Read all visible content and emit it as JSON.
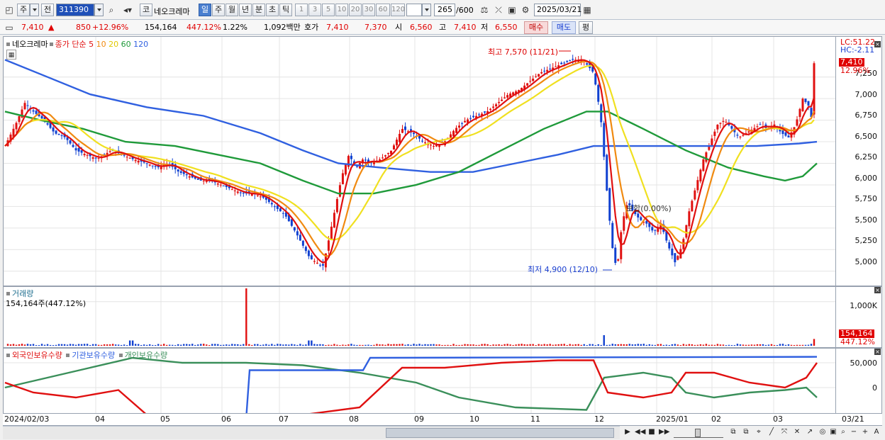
{
  "toolbar": {
    "period_jo": "주",
    "jeon": "전",
    "code": "311390",
    "ko": "코",
    "stock_name": "네오크레마",
    "periods": [
      "일",
      "주",
      "월",
      "년",
      "분",
      "초",
      "틱"
    ],
    "period_selected": "일",
    "numbers": [
      "1",
      "3",
      "5",
      "10",
      "20",
      "30",
      "60",
      "120"
    ],
    "count": "265",
    "count_total": "/600",
    "date": "2025/03/21"
  },
  "quote": {
    "price": "7,410",
    "arrow": "▲",
    "change": "850",
    "change_pct": "+12.96%",
    "volume": "154,164",
    "vol_ratio": "447.12%",
    "turnover": "1.22%",
    "amount": "1,092백만",
    "hoga_label": "호가",
    "ask": "7,410",
    "bid": "7,370",
    "open_label": "시",
    "open": "6,560",
    "high_label": "고",
    "high": "7,410",
    "low_label": "저",
    "low": "6,550",
    "buy": "매수",
    "sell": "매도",
    "eval": "평"
  },
  "price_panel": {
    "stock_name": "네오크레마",
    "ma_label": "종가 단순",
    "ma_periods": [
      "5",
      "10",
      "20",
      "60",
      "120"
    ],
    "ma_colors": [
      "#e01010",
      "#f08a10",
      "#f0e020",
      "#1f9a3a",
      "#3060e0"
    ],
    "y_ticks": [
      "7,250",
      "7,000",
      "6,750",
      "6,500",
      "6,250",
      "6,000",
      "5,750",
      "5,500",
      "5,250",
      "5,000"
    ],
    "lc": "LC:51.22",
    "hc": "HC:-2.11",
    "last_price": "7,410",
    "last_pct": "12.96%",
    "high_annot": "최고 7,570 (11/21)",
    "low_annot": "최저 4,900 (12/10)",
    "mid_annot": "보합(0.00%)"
  },
  "volume_panel": {
    "title": "거래량",
    "value": "154,164주(447.12%)",
    "y_tick": "1,000K",
    "last": "154,164",
    "last_pct": "447.12%"
  },
  "holding_panel": {
    "series": [
      "외국인보유수량",
      "기관보유수량",
      "개인보유수량"
    ],
    "colors": [
      "#e01010",
      "#3060e0",
      "#3a8f5a"
    ],
    "y_ticks": [
      "50,000",
      "0"
    ]
  },
  "x_axis": {
    "labels": [
      "2024/02/03",
      "04",
      "05",
      "06",
      "07",
      "08",
      "09",
      "10",
      "11",
      "12",
      "2025/01",
      "02",
      "03",
      "03/21"
    ]
  },
  "chart_data": [
    {
      "type": "candlestick",
      "title": "네오크레마 종가 단순 5 10 20 60 120",
      "ylim": [
        4850,
        7650
      ],
      "y_ticks": [
        5000,
        5250,
        5500,
        5750,
        6000,
        6250,
        6500,
        6750,
        7000,
        7250
      ],
      "close_path": [
        [
          0,
          6450
        ],
        [
          15,
          6700
        ],
        [
          28,
          6950
        ],
        [
          40,
          6850
        ],
        [
          55,
          6750
        ],
        [
          70,
          6600
        ],
        [
          85,
          6550
        ],
        [
          100,
          6400
        ],
        [
          115,
          6350
        ],
        [
          130,
          6300
        ],
        [
          150,
          6400
        ],
        [
          165,
          6350
        ],
        [
          180,
          6300
        ],
        [
          200,
          6250
        ],
        [
          215,
          6200
        ],
        [
          230,
          6250
        ],
        [
          245,
          6150
        ],
        [
          260,
          6100
        ],
        [
          275,
          6050
        ],
        [
          290,
          6050
        ],
        [
          305,
          6000
        ],
        [
          320,
          5950
        ],
        [
          335,
          5900
        ],
        [
          350,
          5900
        ],
        [
          365,
          5850
        ],
        [
          380,
          5750
        ],
        [
          395,
          5650
        ],
        [
          410,
          5450
        ],
        [
          420,
          5300
        ],
        [
          430,
          5150
        ],
        [
          440,
          5100
        ],
        [
          448,
          5050
        ],
        [
          455,
          5300
        ],
        [
          465,
          5700
        ],
        [
          475,
          6100
        ],
        [
          485,
          6350
        ],
        [
          495,
          6200
        ],
        [
          505,
          6300
        ],
        [
          515,
          6250
        ],
        [
          530,
          6300
        ],
        [
          545,
          6400
        ],
        [
          560,
          6650
        ],
        [
          575,
          6600
        ],
        [
          590,
          6500
        ],
        [
          605,
          6450
        ],
        [
          620,
          6500
        ],
        [
          635,
          6650
        ],
        [
          650,
          6750
        ],
        [
          665,
          6800
        ],
        [
          680,
          6850
        ],
        [
          695,
          6950
        ],
        [
          710,
          7050
        ],
        [
          725,
          7100
        ],
        [
          740,
          7200
        ],
        [
          755,
          7300
        ],
        [
          770,
          7350
        ],
        [
          785,
          7400
        ],
        [
          800,
          7450
        ],
        [
          815,
          7450
        ],
        [
          830,
          7300
        ],
        [
          840,
          6800
        ],
        [
          848,
          6000
        ],
        [
          856,
          5300
        ],
        [
          863,
          5000
        ],
        [
          870,
          5550
        ],
        [
          878,
          5800
        ],
        [
          885,
          5700
        ],
        [
          895,
          5600
        ],
        [
          905,
          5550
        ],
        [
          915,
          5450
        ],
        [
          925,
          5550
        ],
        [
          935,
          5300
        ],
        [
          945,
          5100
        ],
        [
          955,
          5300
        ],
        [
          965,
          5700
        ],
        [
          975,
          6000
        ],
        [
          985,
          6300
        ],
        [
          995,
          6500
        ],
        [
          1005,
          6700
        ],
        [
          1015,
          6750
        ],
        [
          1025,
          6650
        ],
        [
          1035,
          6550
        ],
        [
          1045,
          6600
        ],
        [
          1055,
          6650
        ],
        [
          1065,
          6700
        ],
        [
          1075,
          6650
        ],
        [
          1085,
          6700
        ],
        [
          1095,
          6600
        ],
        [
          1105,
          6550
        ],
        [
          1115,
          6700
        ],
        [
          1125,
          7000
        ],
        [
          1135,
          6900
        ],
        [
          1141,
          6560
        ],
        [
          1145,
          7410
        ]
      ],
      "ma120_path": [
        [
          0,
          7450
        ],
        [
          60,
          7250
        ],
        [
          120,
          7050
        ],
        [
          200,
          6900
        ],
        [
          280,
          6800
        ],
        [
          360,
          6600
        ],
        [
          420,
          6400
        ],
        [
          470,
          6250
        ],
        [
          530,
          6200
        ],
        [
          600,
          6150
        ],
        [
          660,
          6150
        ],
        [
          720,
          6250
        ],
        [
          780,
          6350
        ],
        [
          830,
          6450
        ],
        [
          880,
          6450
        ],
        [
          940,
          6450
        ],
        [
          1000,
          6450
        ],
        [
          1060,
          6450
        ],
        [
          1120,
          6480
        ],
        [
          1145,
          6500
        ]
      ],
      "ma60_path": [
        [
          0,
          6850
        ],
        [
          50,
          6750
        ],
        [
          110,
          6650
        ],
        [
          170,
          6500
        ],
        [
          240,
          6450
        ],
        [
          300,
          6350
        ],
        [
          360,
          6250
        ],
        [
          420,
          6050
        ],
        [
          470,
          5900
        ],
        [
          520,
          5900
        ],
        [
          580,
          6000
        ],
        [
          640,
          6150
        ],
        [
          700,
          6400
        ],
        [
          760,
          6650
        ],
        [
          820,
          6850
        ],
        [
          850,
          6850
        ],
        [
          900,
          6650
        ],
        [
          960,
          6400
        ],
        [
          1020,
          6200
        ],
        [
          1070,
          6100
        ],
        [
          1100,
          6050
        ],
        [
          1125,
          6100
        ],
        [
          1145,
          6250
        ]
      ],
      "high_point": {
        "date": "11/21",
        "value": 7570
      },
      "low_point": {
        "date": "12/10",
        "value": 4900
      },
      "last": {
        "value": 7410,
        "change_pct": 12.96
      }
    },
    {
      "type": "bar",
      "title": "거래량",
      "ylim": [
        0,
        1300000
      ],
      "y_ticks": [
        1000000
      ],
      "spikes": [
        [
          180,
          120000
        ],
        [
          341,
          1300000
        ],
        [
          432,
          120000
        ],
        [
          846,
          240000
        ],
        [
          1145,
          154164
        ]
      ],
      "baseline_level": 35000
    },
    {
      "type": "line",
      "title": "외국인보유수량 기관보유수량 개인보유수량",
      "y_ticks": [
        50000,
        0
      ],
      "series": [
        {
          "name": "외국인보유수량",
          "points": [
            [
              0,
              10000
            ],
            [
              40,
              -10000
            ],
            [
              100,
              -20000
            ],
            [
              160,
              -5000
            ],
            [
              200,
              -55000
            ],
            [
              260,
              -55000
            ],
            [
              340,
              -55000
            ],
            [
              420,
              -55000
            ],
            [
              500,
              -40000
            ],
            [
              560,
              40000
            ],
            [
              620,
              40000
            ],
            [
              700,
              50000
            ],
            [
              780,
              55000
            ],
            [
              830,
              55000
            ],
            [
              850,
              -10000
            ],
            [
              900,
              -20000
            ],
            [
              940,
              -10000
            ],
            [
              960,
              30000
            ],
            [
              1000,
              30000
            ],
            [
              1050,
              10000
            ],
            [
              1100,
              0
            ],
            [
              1130,
              20000
            ],
            [
              1145,
              50000
            ]
          ]
        },
        {
          "name": "기관보유수량",
          "points": [
            [
              0,
              -65000
            ],
            [
              340,
              -65000
            ],
            [
              345,
              35000
            ],
            [
              505,
              35000
            ],
            [
              515,
              60000
            ],
            [
              1145,
              62000
            ]
          ]
        },
        {
          "name": "개인보유수량",
          "points": [
            [
              0,
              0
            ],
            [
              60,
              20000
            ],
            [
              120,
              40000
            ],
            [
              180,
              60000
            ],
            [
              250,
              50000
            ],
            [
              340,
              50000
            ],
            [
              420,
              45000
            ],
            [
              500,
              30000
            ],
            [
              580,
              10000
            ],
            [
              640,
              -20000
            ],
            [
              720,
              -40000
            ],
            [
              820,
              -45000
            ],
            [
              845,
              20000
            ],
            [
              900,
              30000
            ],
            [
              940,
              20000
            ],
            [
              960,
              -10000
            ],
            [
              1000,
              -20000
            ],
            [
              1050,
              -10000
            ],
            [
              1100,
              -5000
            ],
            [
              1130,
              0
            ],
            [
              1145,
              -20000
            ]
          ]
        }
      ]
    }
  ]
}
